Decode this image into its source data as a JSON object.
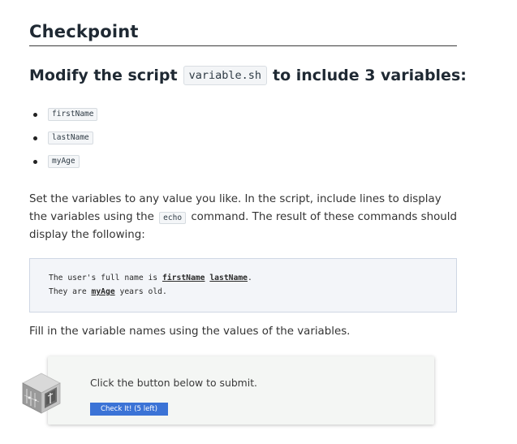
{
  "heading": "Checkpoint",
  "task": {
    "prefix": "Modify the script",
    "script_name": "variable.sh",
    "suffix": "to include 3 variables:"
  },
  "variables": [
    {
      "name": "firstName"
    },
    {
      "name": "lastName"
    },
    {
      "name": "myAge"
    }
  ],
  "instructions": {
    "part1": "Set the variables to any value you like. In the script, include lines to display the variables using the",
    "command": "echo",
    "part2": "command. The result of these commands should display the following:"
  },
  "expected_output": {
    "line1": {
      "prefix": "The user's full name is ",
      "var1": "firstName",
      "space": " ",
      "var2": "lastName",
      "suffix": "."
    },
    "line2": {
      "prefix": "They are ",
      "var": "myAge",
      "suffix": " years old."
    }
  },
  "fill_in_note": "Fill in the variable names using the values of the variables.",
  "submit": {
    "prompt": "Click the button below to submit.",
    "button_label": "Check It! (5 left)",
    "icon": "cube-icon"
  },
  "colors": {
    "button": "#3b73d6",
    "code_bg": "#f3f5f9",
    "card_bg": "#f4f6f4"
  }
}
